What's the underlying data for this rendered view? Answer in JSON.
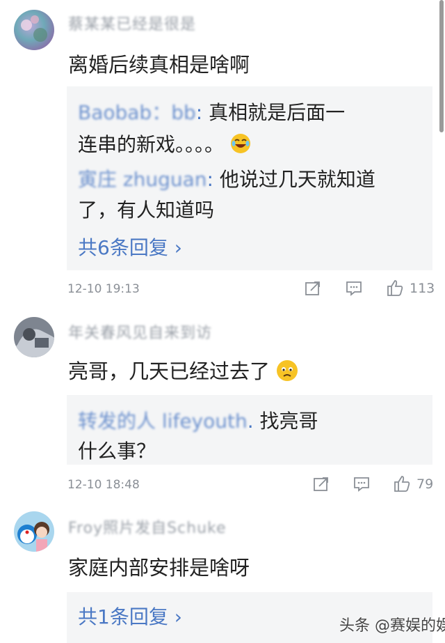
{
  "comments": [
    {
      "username": "蔡某某已经是很是",
      "text": "离婚后续真相是啥啊",
      "replies": [
        {
          "user": "Baobab：bb",
          "sep": ":",
          "text": " 真相就是后面一",
          "cont": "连串的新戏。。。。"
        },
        {
          "user": "寅庄 zhuguan",
          "sep": ":",
          "text": " 他说过几天就知道",
          "cont": "了，有人知道吗"
        }
      ],
      "more": "共6条回复 ›",
      "time": "12-10 19:13",
      "likes": "113"
    },
    {
      "username": "年关春风见自来到访",
      "text": "亮哥，几天已经过去了",
      "replies": [
        {
          "user": "转发的人 lifeyouth",
          "sep": ".",
          "text": " 找亮哥",
          "cont": "什么事？"
        }
      ],
      "time": "12-10 18:48",
      "likes": "79"
    },
    {
      "username": "Froy照片发自Schuke",
      "text": "家庭内部安排是啥呀",
      "more": "共1条回复 ›"
    }
  ],
  "watermark": "头条 @赛娱的娱乐",
  "icons": {
    "share": "share-icon",
    "comment": "comment-icon",
    "like": "thumbs-up-icon"
  }
}
